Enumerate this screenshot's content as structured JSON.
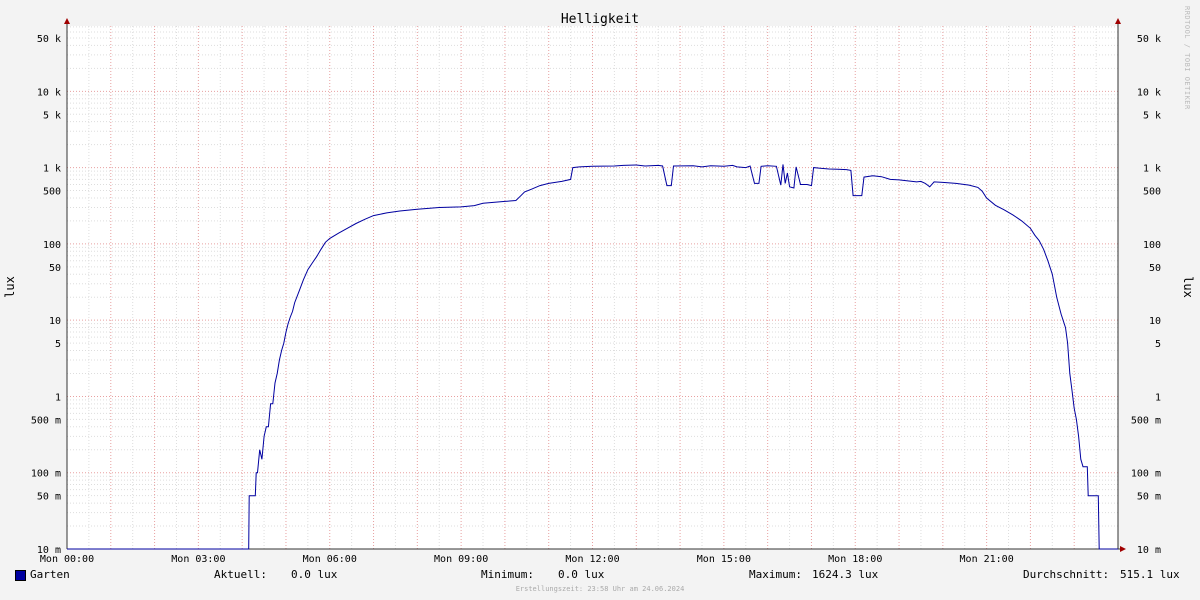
{
  "chart_data": {
    "type": "line",
    "title": "Helligkeit",
    "ylabel": "lux",
    "ylabel_right": "lux",
    "y_scale": "log",
    "ylim": [
      0.01,
      70000
    ],
    "xlim": [
      0,
      24
    ],
    "grid": true,
    "x_ticks": [
      {
        "x": 0,
        "label": "Mon 00:00"
      },
      {
        "x": 3,
        "label": "Mon 03:00"
      },
      {
        "x": 6,
        "label": "Mon 06:00"
      },
      {
        "x": 9,
        "label": "Mon 09:00"
      },
      {
        "x": 12,
        "label": "Mon 12:00"
      },
      {
        "x": 15,
        "label": "Mon 15:00"
      },
      {
        "x": 18,
        "label": "Mon 18:00"
      },
      {
        "x": 21,
        "label": "Mon 21:00"
      }
    ],
    "y_ticks": [
      {
        "y": 50000,
        "label": "50 k"
      },
      {
        "y": 10000,
        "label": "10 k"
      },
      {
        "y": 5000,
        "label": "5 k"
      },
      {
        "y": 1000,
        "label": "1 k"
      },
      {
        "y": 500,
        "label": "500"
      },
      {
        "y": 100,
        "label": "100"
      },
      {
        "y": 50,
        "label": "50"
      },
      {
        "y": 10,
        "label": "10"
      },
      {
        "y": 5,
        "label": "5"
      },
      {
        "y": 1,
        "label": "1"
      },
      {
        "y": 0.5,
        "label": "500 m"
      },
      {
        "y": 0.1,
        "label": "100 m"
      },
      {
        "y": 0.05,
        "label": "50 m"
      },
      {
        "y": 0.01,
        "label": "10 m"
      }
    ],
    "series": [
      {
        "name": "Garten",
        "color": "#0000a0",
        "points": [
          [
            0,
            0.01
          ],
          [
            4.15,
            0.01
          ],
          [
            4.16,
            0.05
          ],
          [
            4.3,
            0.05
          ],
          [
            4.32,
            0.1
          ],
          [
            4.35,
            0.1
          ],
          [
            4.4,
            0.2
          ],
          [
            4.45,
            0.15
          ],
          [
            4.5,
            0.3
          ],
          [
            4.55,
            0.4
          ],
          [
            4.6,
            0.4
          ],
          [
            4.65,
            0.8
          ],
          [
            4.7,
            0.8
          ],
          [
            4.75,
            1.5
          ],
          [
            4.8,
            2
          ],
          [
            4.85,
            3
          ],
          [
            4.9,
            4
          ],
          [
            4.95,
            5
          ],
          [
            5.0,
            7
          ],
          [
            5.05,
            9
          ],
          [
            5.1,
            11
          ],
          [
            5.15,
            13
          ],
          [
            5.2,
            17
          ],
          [
            5.3,
            24
          ],
          [
            5.4,
            34
          ],
          [
            5.5,
            46
          ],
          [
            5.6,
            56
          ],
          [
            5.7,
            68
          ],
          [
            5.8,
            85
          ],
          [
            5.9,
            105
          ],
          [
            6.0,
            118
          ],
          [
            6.2,
            138
          ],
          [
            6.4,
            160
          ],
          [
            6.6,
            185
          ],
          [
            6.8,
            210
          ],
          [
            7.0,
            235
          ],
          [
            7.3,
            255
          ],
          [
            7.6,
            270
          ],
          [
            8.0,
            285
          ],
          [
            8.5,
            300
          ],
          [
            9.0,
            305
          ],
          [
            9.3,
            318
          ],
          [
            9.5,
            340
          ],
          [
            10.0,
            360
          ],
          [
            10.25,
            370
          ],
          [
            10.35,
            420
          ],
          [
            10.45,
            480
          ],
          [
            10.6,
            520
          ],
          [
            10.8,
            580
          ],
          [
            11.0,
            620
          ],
          [
            11.3,
            660
          ],
          [
            11.5,
            700
          ],
          [
            11.55,
            1000
          ],
          [
            11.7,
            1020
          ],
          [
            12.0,
            1040
          ],
          [
            12.5,
            1050
          ],
          [
            12.7,
            1070
          ],
          [
            13.0,
            1080
          ],
          [
            13.2,
            1050
          ],
          [
            13.5,
            1070
          ],
          [
            13.6,
            1050
          ],
          [
            13.7,
            580
          ],
          [
            13.8,
            580
          ],
          [
            13.85,
            1050
          ],
          [
            14.3,
            1060
          ],
          [
            14.5,
            1020
          ],
          [
            14.7,
            1060
          ],
          [
            15.0,
            1040
          ],
          [
            15.2,
            1070
          ],
          [
            15.3,
            1020
          ],
          [
            15.5,
            1000
          ],
          [
            15.6,
            1050
          ],
          [
            15.7,
            620
          ],
          [
            15.8,
            620
          ],
          [
            15.85,
            1040
          ],
          [
            16.0,
            1060
          ],
          [
            16.2,
            1040
          ],
          [
            16.3,
            590
          ],
          [
            16.35,
            1100
          ],
          [
            16.4,
            620
          ],
          [
            16.45,
            850
          ],
          [
            16.5,
            560
          ],
          [
            16.6,
            540
          ],
          [
            16.65,
            1020
          ],
          [
            16.75,
            600
          ],
          [
            16.9,
            600
          ],
          [
            17.0,
            580
          ],
          [
            17.05,
            1000
          ],
          [
            17.2,
            980
          ],
          [
            17.4,
            960
          ],
          [
            17.6,
            950
          ],
          [
            17.8,
            940
          ],
          [
            17.9,
            920
          ],
          [
            17.95,
            430
          ],
          [
            18.15,
            430
          ],
          [
            18.2,
            750
          ],
          [
            18.4,
            780
          ],
          [
            18.6,
            760
          ],
          [
            18.8,
            700
          ],
          [
            19.0,
            690
          ],
          [
            19.2,
            670
          ],
          [
            19.4,
            650
          ],
          [
            19.5,
            660
          ],
          [
            19.6,
            620
          ],
          [
            19.7,
            560
          ],
          [
            19.8,
            650
          ],
          [
            20.0,
            640
          ],
          [
            20.3,
            620
          ],
          [
            20.6,
            590
          ],
          [
            20.8,
            550
          ],
          [
            20.9,
            490
          ],
          [
            21.0,
            400
          ],
          [
            21.2,
            320
          ],
          [
            21.4,
            280
          ],
          [
            21.6,
            240
          ],
          [
            21.8,
            200
          ],
          [
            22.0,
            160
          ],
          [
            22.1,
            130
          ],
          [
            22.2,
            110
          ],
          [
            22.3,
            85
          ],
          [
            22.4,
            60
          ],
          [
            22.5,
            40
          ],
          [
            22.6,
            20
          ],
          [
            22.7,
            12
          ],
          [
            22.8,
            8
          ],
          [
            22.85,
            5
          ],
          [
            22.9,
            2
          ],
          [
            22.95,
            1.2
          ],
          [
            23.0,
            0.7
          ],
          [
            23.05,
            0.5
          ],
          [
            23.1,
            0.3
          ],
          [
            23.15,
            0.15
          ],
          [
            23.2,
            0.12
          ],
          [
            23.3,
            0.12
          ],
          [
            23.32,
            0.05
          ],
          [
            23.55,
            0.05
          ],
          [
            23.57,
            0.01
          ],
          [
            24,
            0.01
          ]
        ]
      }
    ]
  },
  "legend": {
    "series_name": "Garten",
    "current_label": "Aktuell:",
    "current_value": "0.0 lux",
    "min_label": "Minimum:",
    "min_value": "0.0 lux",
    "max_label": "Maximum:",
    "max_value": "1624.3 lux",
    "avg_label": "Durchschnitt:",
    "avg_value": "515.1 lux"
  },
  "footer": "Erstellungszeit: 23:58 Uhr am 24.06.2024",
  "watermark": "RRDTOOL / TOBI OETIKER",
  "colors": {
    "background": "#f3f3f3",
    "plot": "#ffffff",
    "series": "#0000a0",
    "grid_major": "#e8a0a0",
    "grid_minor": "#dddddd",
    "axis": "#333333"
  }
}
